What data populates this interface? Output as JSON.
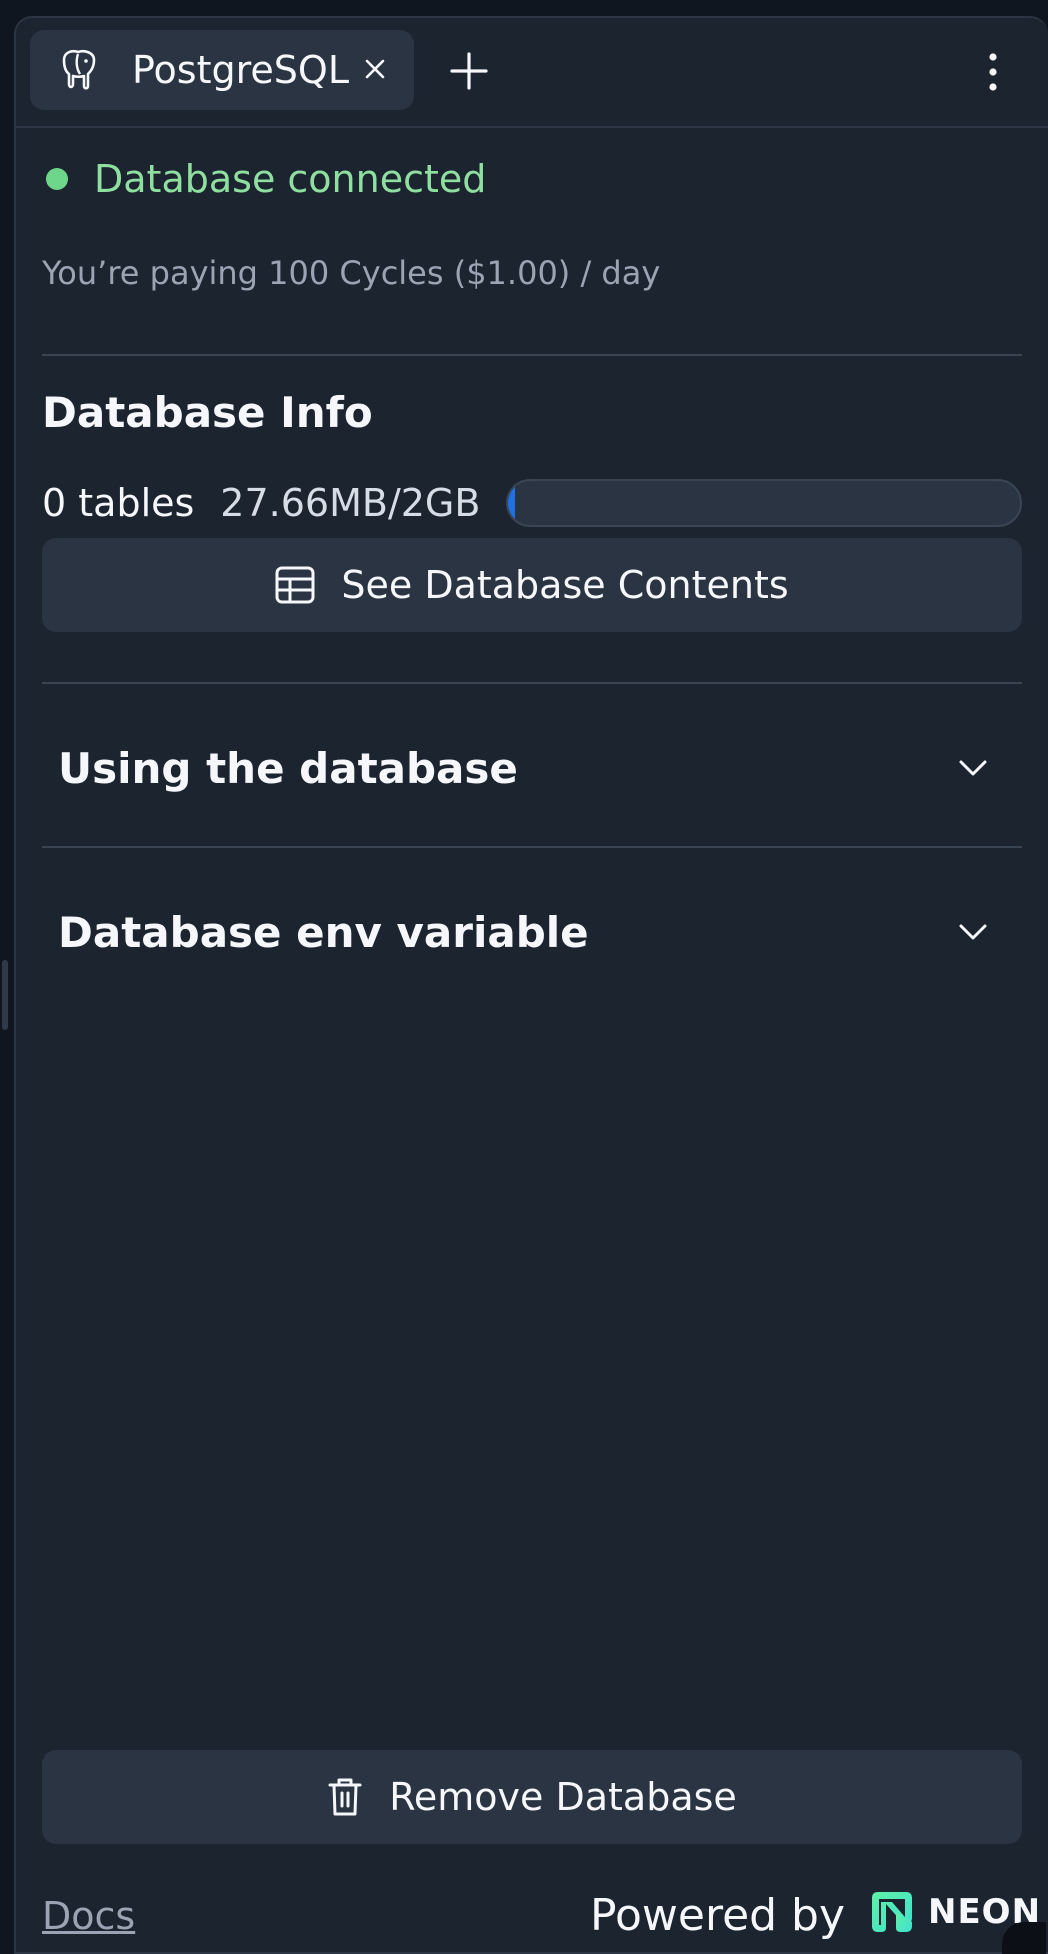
{
  "tab": {
    "label": "PostgreSQL",
    "icon": "postgresql-elephant-icon"
  },
  "status": {
    "text": "Database connected",
    "color": "#6ed68a"
  },
  "billing": {
    "text": "You’re paying 100 Cycles ($1.00) / day"
  },
  "database_info": {
    "title": "Database Info",
    "tables": "0 tables",
    "storage": "27.66MB/2GB",
    "usage_fraction": 0.0135,
    "see_contents_label": "See Database Contents"
  },
  "accordions": [
    {
      "title": "Using the database"
    },
    {
      "title": "Database env variable"
    }
  ],
  "remove_label": "Remove Database",
  "footer": {
    "docs": "Docs",
    "powered_by": "Powered by",
    "brand": "NEON"
  },
  "colors": {
    "accent_blue": "#1f6fe5",
    "neon_green": "#5ef2a6",
    "neon_teal": "#3ee0d0"
  }
}
